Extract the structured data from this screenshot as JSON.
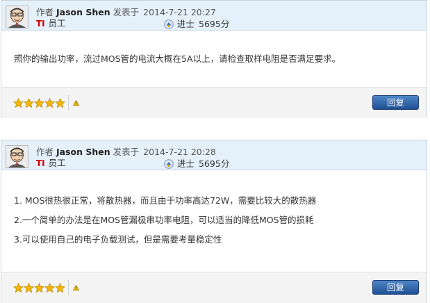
{
  "posts": [
    {
      "author_prefix": "作者",
      "author_name": "Jason Shen",
      "posted_label": "发表于",
      "date": "2014-7-21 20:27",
      "badge_ti": "TI",
      "badge_role": "员工",
      "rank_label": "进士",
      "points": "5695分",
      "content": [
        "照你的输出功率，流过MOS管的电流大概在5A以上，请检查取样电阻是否满足要求。"
      ],
      "rating_stars": 5,
      "reply_label": "回复"
    },
    {
      "author_prefix": "作者",
      "author_name": "Jason Shen",
      "posted_label": "发表于",
      "date": "2014-7-21 20:28",
      "badge_ti": "TI",
      "badge_role": "员工",
      "rank_label": "进士",
      "points": "5695分",
      "content": [
        "1. MOS很热很正常，将散热器，而且由于功率高达72W，需要比较大的散热器",
        "2.一个简单的办法是在MOS管漏极串功率电阻，可以适当的降低MOS管的损耗",
        "3.可以使用自己的电子负载测试，但是需要考量稳定性"
      ],
      "rating_stars": 5,
      "reply_label": "回复"
    }
  ],
  "colors": {
    "header_bg": "#e4f0fa",
    "reply_button": "#2a5ea8",
    "badge_red": "#cc0000",
    "star": "#f2b705"
  },
  "icons": {
    "avatar": "avatar-caricature",
    "level": "level-badge-icon",
    "rating": "star-icon",
    "report": "warning-triangle-icon"
  }
}
